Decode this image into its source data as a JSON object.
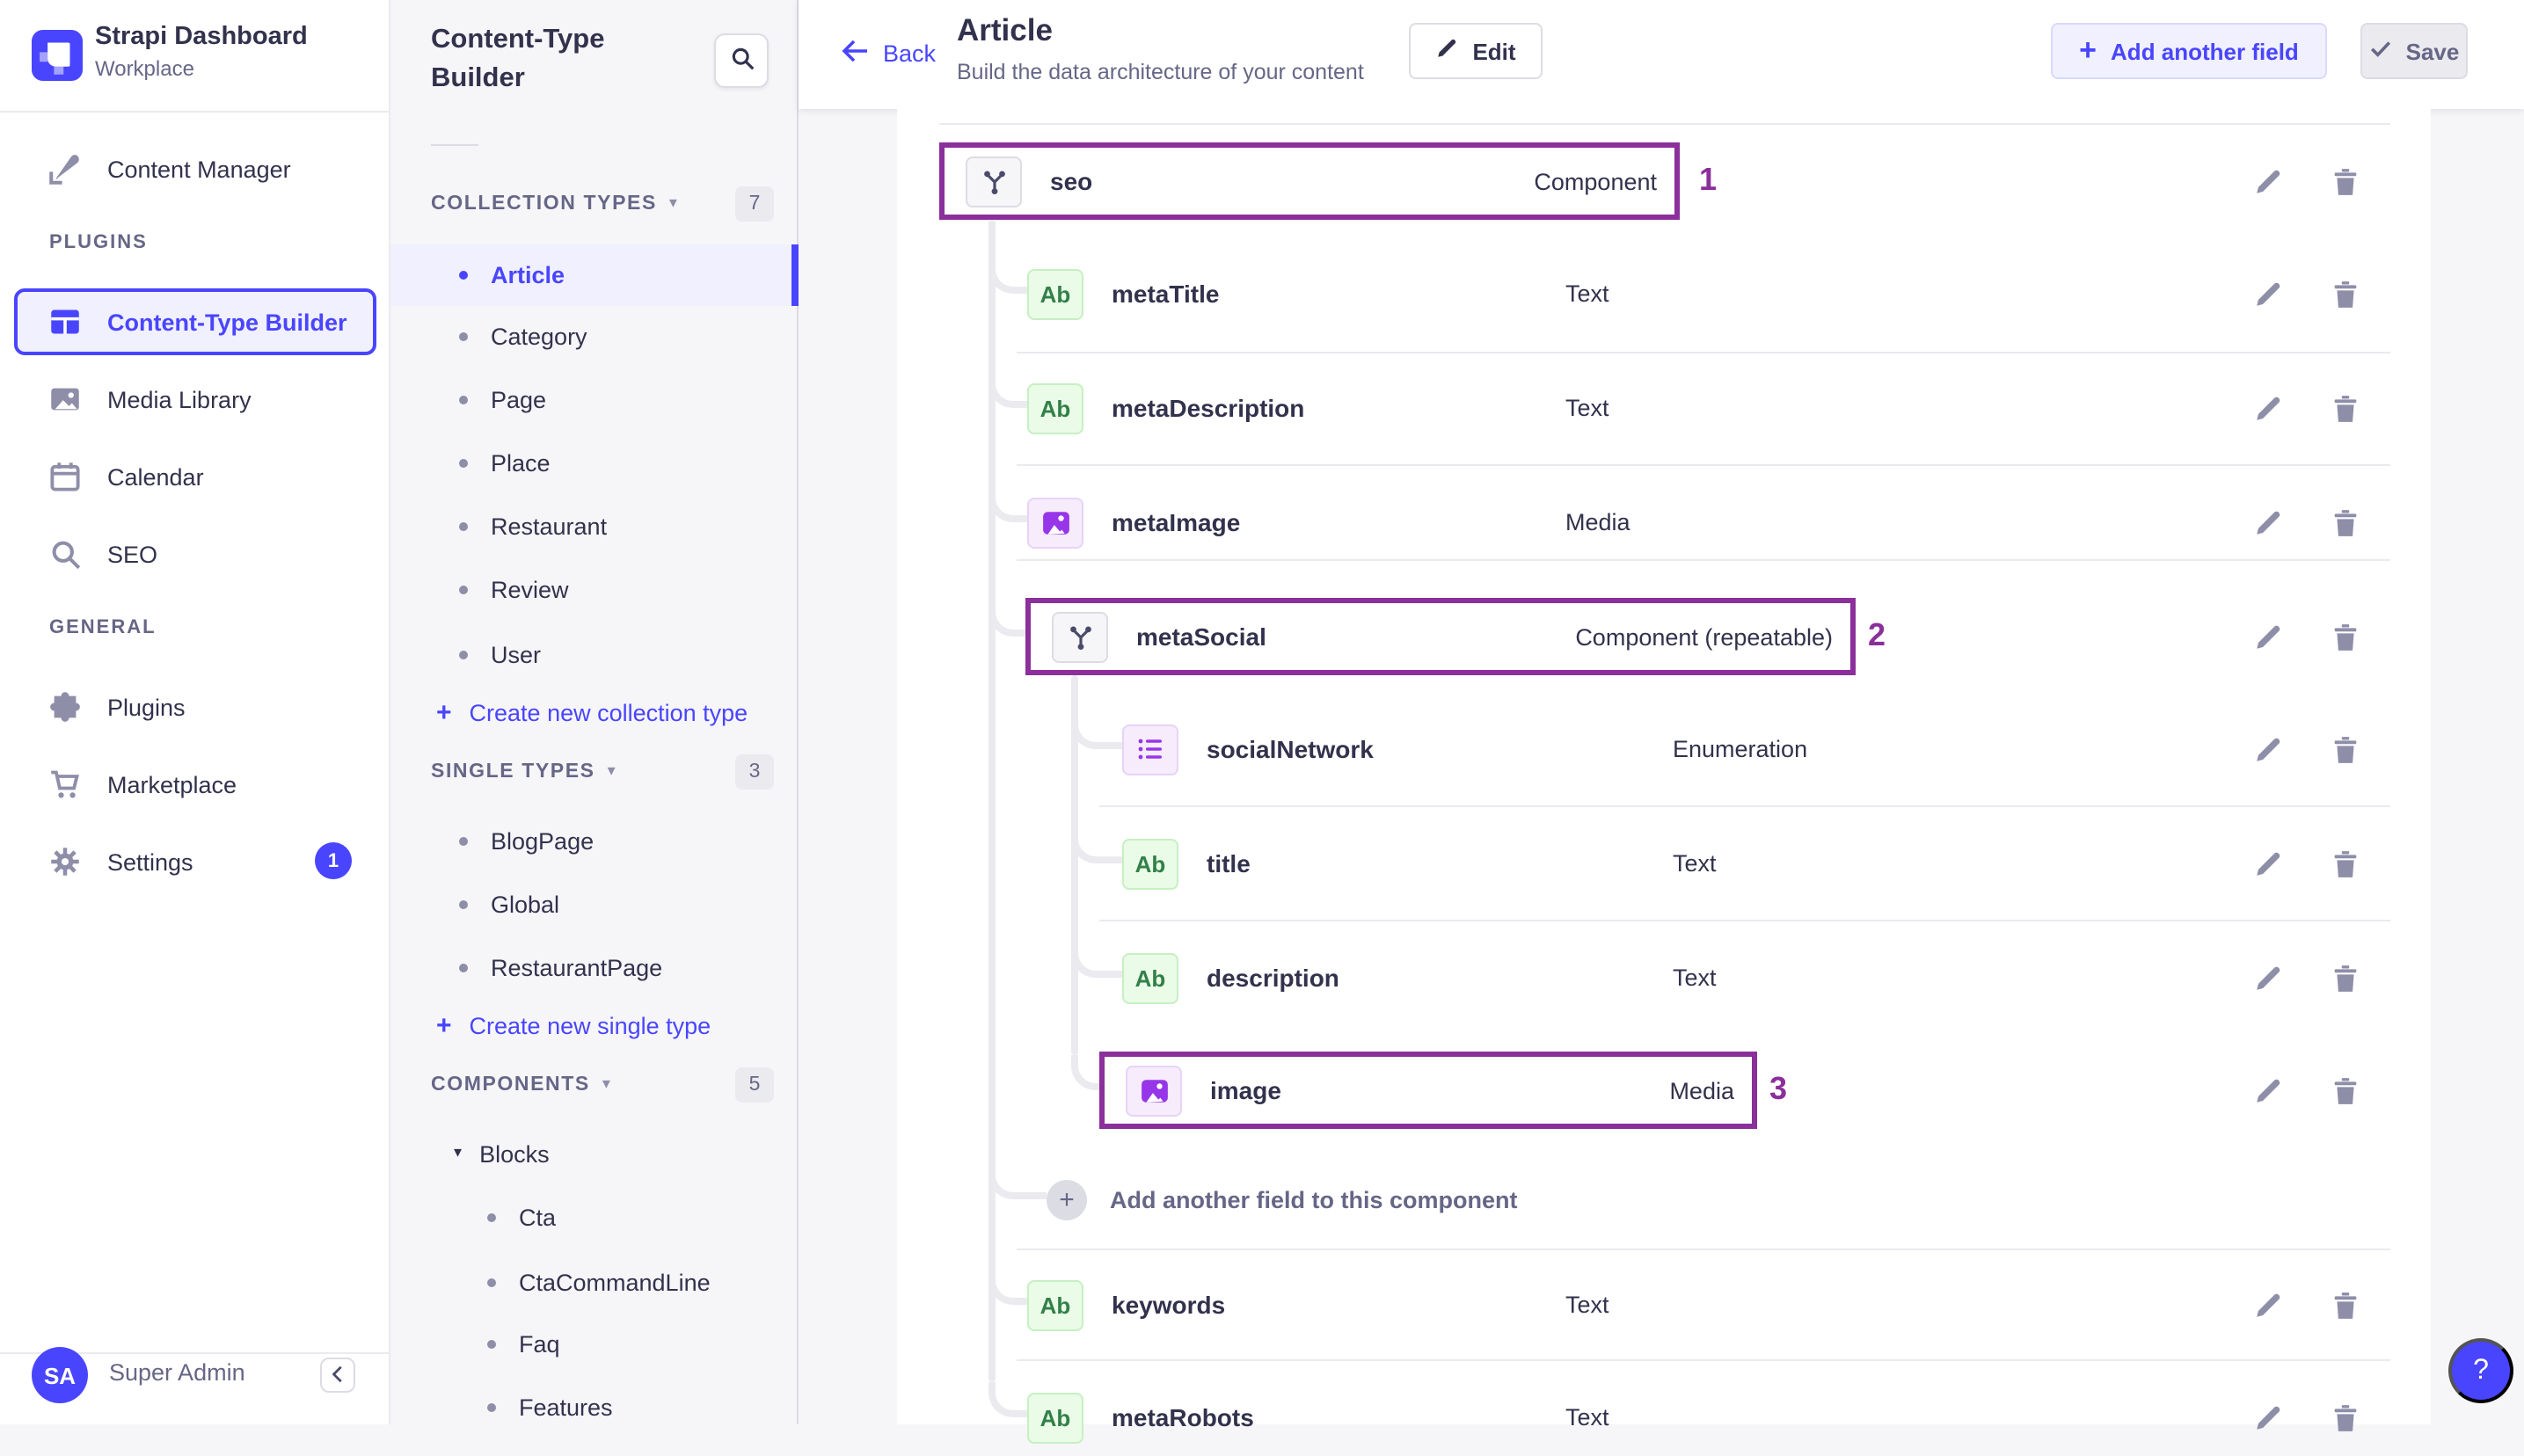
{
  "app": {
    "name": "Strapi Dashboard",
    "workspace": "Workplace"
  },
  "glyphs": {
    "caret_down": "▾",
    "plus": "+",
    "question": "?"
  },
  "nav": {
    "content_manager": "Content Manager",
    "plugins_section": "PLUGINS",
    "content_type_builder": "Content-Type Builder",
    "media_library": "Media Library",
    "calendar": "Calendar",
    "seo": "SEO",
    "general_section": "GENERAL",
    "plugins": "Plugins",
    "marketplace": "Marketplace",
    "settings": "Settings",
    "settings_badge": "1",
    "user_initials": "SA",
    "user_name": "Super Admin"
  },
  "builder": {
    "title": "Content-Type Builder",
    "collection_types": {
      "label": "COLLECTION TYPES",
      "count": "7",
      "items": [
        "Article",
        "Category",
        "Page",
        "Place",
        "Restaurant",
        "Review",
        "User"
      ],
      "create": "Create new collection type"
    },
    "single_types": {
      "label": "SINGLE TYPES",
      "count": "3",
      "items": [
        "BlogPage",
        "Global",
        "RestaurantPage"
      ],
      "create": "Create new single type"
    },
    "components": {
      "label": "COMPONENTS",
      "count": "5",
      "group": "Blocks",
      "items": [
        "Cta",
        "CtaCommandLine",
        "Faq",
        "Features"
      ]
    }
  },
  "header": {
    "back": "Back",
    "title": "Article",
    "subtitle": "Build the data architecture of your content",
    "edit": "Edit",
    "add_field": "Add another field",
    "save": "Save"
  },
  "fields": [
    {
      "name": "seo",
      "type": "Component",
      "annotation": "1"
    },
    {
      "name": "metaTitle",
      "type": "Text"
    },
    {
      "name": "metaDescription",
      "type": "Text"
    },
    {
      "name": "metaImage",
      "type": "Media"
    },
    {
      "name": "metaSocial",
      "type": "Component (repeatable)",
      "annotation": "2"
    },
    {
      "name": "socialNetwork",
      "type": "Enumeration"
    },
    {
      "name": "title",
      "type": "Text"
    },
    {
      "name": "description",
      "type": "Text"
    },
    {
      "name": "image",
      "type": "Media",
      "annotation": "3"
    },
    {
      "name": "keywords",
      "type": "Text"
    },
    {
      "name": "metaRobots",
      "type": "Text"
    }
  ],
  "add_component_field": "Add another field to this component",
  "colors": {
    "primary": "#4945FF",
    "annotation": "#8B2F9B",
    "text_dark": "#32324D",
    "text_muted": "#666687",
    "success_text": "#328048",
    "alt_purple": "#9736E8"
  }
}
